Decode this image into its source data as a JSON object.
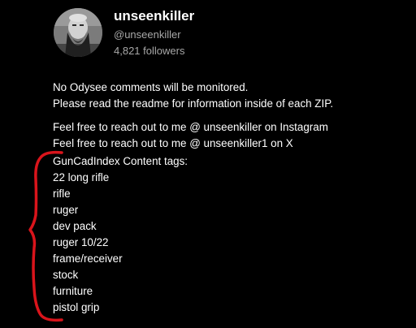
{
  "channel": {
    "name": "unseenkiller",
    "handle": "@unseenkiller",
    "followers": "4,821 followers"
  },
  "description": {
    "paragraph_1": [
      "No Odysee comments will be monitored.",
      "Please read the readme for information inside of each ZIP."
    ],
    "paragraph_2": [
      "Feel free to reach out to me @ unseenkiller on Instagram",
      "Feel free to reach out to me @ unseenkiller1 on X"
    ],
    "tags_heading": "GunCadIndex Content tags:",
    "tags": [
      "22 long rifle",
      "rifle",
      "ruger",
      "dev pack",
      "ruger 10/22",
      "frame/receiver",
      "stock",
      "furniture",
      "pistol grip"
    ]
  },
  "colors": {
    "background": "#000000",
    "text_primary": "#ffffff",
    "text_secondary": "#a8a8a8",
    "annotation_bracket": "#d9141b"
  }
}
